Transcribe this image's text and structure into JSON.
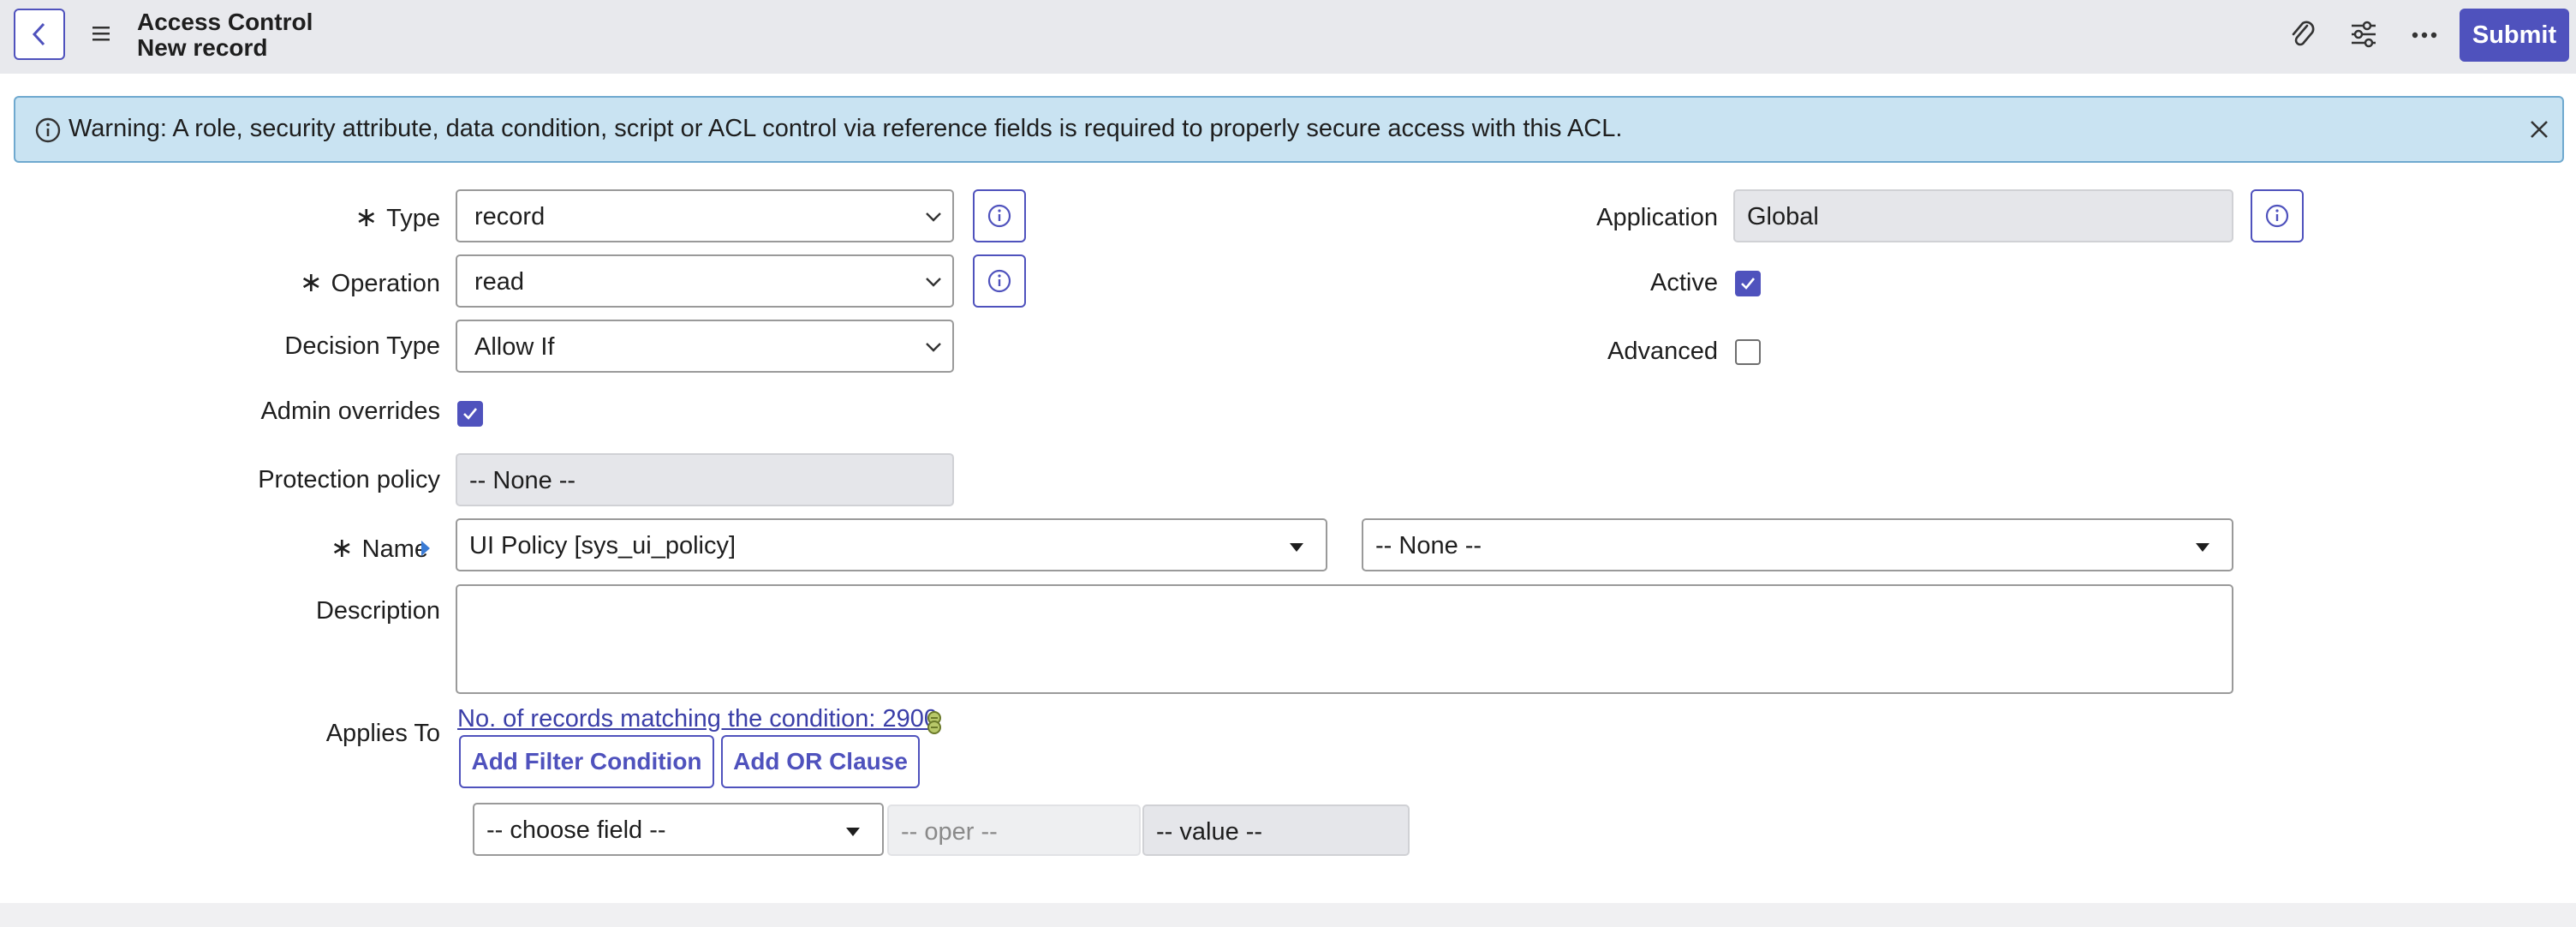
{
  "header": {
    "title": "Access Control",
    "subtitle": "New record",
    "submit_label": "Submit",
    "icons": [
      "back-icon",
      "menu-icon",
      "paperclip-icon",
      "sliders-icon",
      "more-icon"
    ]
  },
  "warning": {
    "text": "Warning: A role, security attribute, data condition, script or ACL control via reference fields is required to properly secure access with this ACL."
  },
  "form": {
    "type": {
      "label": "Type",
      "value": "record"
    },
    "operation": {
      "label": "Operation",
      "value": "read"
    },
    "decision_type": {
      "label": "Decision Type",
      "value": "Allow If"
    },
    "admin_overrides": {
      "label": "Admin overrides",
      "checked": true
    },
    "protection_policy": {
      "label": "Protection policy",
      "value": "-- None --"
    },
    "name": {
      "label": "Name",
      "table_value": "UI Policy [sys_ui_policy]",
      "field_value": "-- None --"
    },
    "description": {
      "label": "Description",
      "value": ""
    },
    "application": {
      "label": "Application",
      "value": "Global"
    },
    "active": {
      "label": "Active",
      "checked": true
    },
    "advanced": {
      "label": "Advanced",
      "checked": false
    },
    "required_marker": "∗"
  },
  "applies_to": {
    "label": "Applies To",
    "records_link": "No. of records matching the condition: 2900",
    "add_filter_label": "Add Filter Condition",
    "add_or_label": "Add OR Clause",
    "choose_field": "-- choose field --",
    "oper_placeholder": "-- oper --",
    "value_placeholder": "-- value --"
  },
  "colors": {
    "accent": "#4f52bd",
    "header_bg": "#e8e9ed",
    "warning_bg": "#c9e3f2"
  }
}
